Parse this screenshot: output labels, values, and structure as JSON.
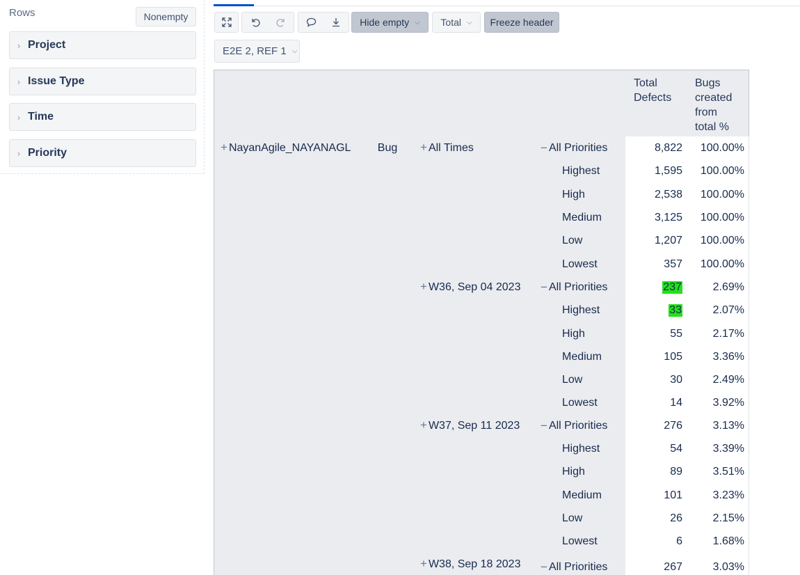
{
  "sidebar": {
    "title": "Rows",
    "nonempty_label": "Nonempty",
    "dimensions": [
      {
        "label": "Project"
      },
      {
        "label": "Issue Type"
      },
      {
        "label": "Time"
      },
      {
        "label": "Priority"
      }
    ]
  },
  "toolbar": {
    "hide_empty_label": "Hide empty",
    "total_label": "Total",
    "freeze_header_label": "Freeze header",
    "icons": [
      "expand-icon",
      "undo-icon",
      "redo-icon",
      "comment-icon",
      "download-icon"
    ]
  },
  "cube_selector": {
    "label": "E2E 2, REF 1"
  },
  "table": {
    "measures": [
      "Total Defects",
      "Bugs created from total %"
    ],
    "project": "NayanAgile_NAYANAGL",
    "issue_type": "Bug",
    "groups": [
      {
        "time": "All Times",
        "rows": [
          {
            "priority": "All Priorities",
            "defects": "8,822",
            "pct": "100.00%"
          },
          {
            "priority": "Highest",
            "defects": "1,595",
            "pct": "100.00%"
          },
          {
            "priority": "High",
            "defects": "2,538",
            "pct": "100.00%"
          },
          {
            "priority": "Medium",
            "defects": "3,125",
            "pct": "100.00%"
          },
          {
            "priority": "Low",
            "defects": "1,207",
            "pct": "100.00%"
          },
          {
            "priority": "Lowest",
            "defects": "357",
            "pct": "100.00%"
          }
        ]
      },
      {
        "time": "W36, Sep 04 2023",
        "rows": [
          {
            "priority": "All Priorities",
            "defects": "237",
            "pct": "2.69%",
            "highlight": true
          },
          {
            "priority": "Highest",
            "defects": "33",
            "pct": "2.07%",
            "highlight": true
          },
          {
            "priority": "High",
            "defects": "55",
            "pct": "2.17%"
          },
          {
            "priority": "Medium",
            "defects": "105",
            "pct": "3.36%"
          },
          {
            "priority": "Low",
            "defects": "30",
            "pct": "2.49%"
          },
          {
            "priority": "Lowest",
            "defects": "14",
            "pct": "3.92%"
          }
        ]
      },
      {
        "time": "W37, Sep 11 2023",
        "rows": [
          {
            "priority": "All Priorities",
            "defects": "276",
            "pct": "3.13%"
          },
          {
            "priority": "Highest",
            "defects": "54",
            "pct": "3.39%"
          },
          {
            "priority": "High",
            "defects": "89",
            "pct": "3.51%"
          },
          {
            "priority": "Medium",
            "defects": "101",
            "pct": "3.23%"
          },
          {
            "priority": "Low",
            "defects": "26",
            "pct": "2.15%"
          },
          {
            "priority": "Lowest",
            "defects": "6",
            "pct": "1.68%"
          }
        ]
      },
      {
        "time": "W38, Sep 18 2023",
        "rows": [
          {
            "priority": "All Priorities",
            "defects": "267",
            "pct": "3.03%"
          }
        ]
      }
    ]
  },
  "colors": {
    "highlight": "#22e21a",
    "header_bg": "#ebecf0"
  }
}
